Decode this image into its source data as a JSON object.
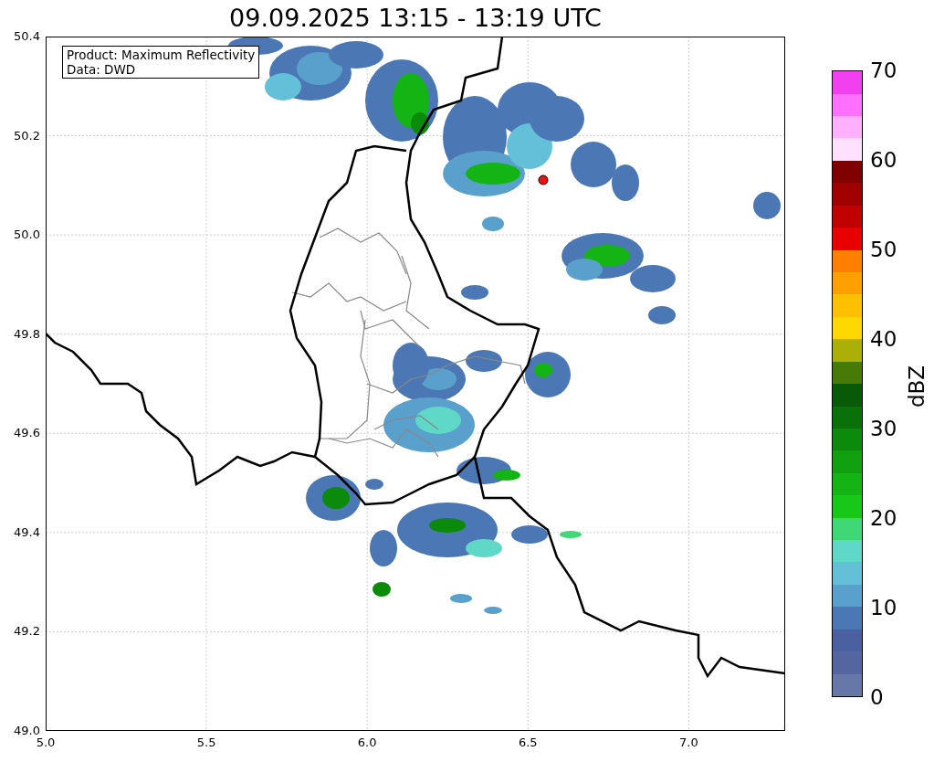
{
  "title": "09.09.2025 13:15 - 13:19 UTC",
  "info_box": [
    "Product: Maximum Reflectivity",
    "Data: DWD"
  ],
  "yticks": [
    "50.4",
    "50.2",
    "50.0",
    "49.8",
    "49.6",
    "49.4",
    "49.2",
    "49.0"
  ],
  "xticks": [
    "5.0",
    "5.5",
    "6.0",
    "6.5",
    "7.0"
  ],
  "colorbar": {
    "label": "dBZ",
    "ticks": [
      "70",
      "60",
      "50",
      "40",
      "30",
      "20",
      "10",
      "0"
    ],
    "segments": [
      {
        "color": "#6777a8"
      },
      {
        "color": "#5565a0"
      },
      {
        "color": "#4a60a0"
      },
      {
        "color": "#4b78b4"
      },
      {
        "color": "#5aa0cc"
      },
      {
        "color": "#63c0d8"
      },
      {
        "color": "#60d8c8"
      },
      {
        "color": "#40d877"
      },
      {
        "color": "#18c818"
      },
      {
        "color": "#14b414"
      },
      {
        "color": "#10a010"
      },
      {
        "color": "#0c8a0c"
      },
      {
        "color": "#0a700a"
      },
      {
        "color": "#085a08"
      },
      {
        "color": "#487a08"
      },
      {
        "color": "#aab008"
      },
      {
        "color": "#ffd800"
      },
      {
        "color": "#ffc000"
      },
      {
        "color": "#ffa000"
      },
      {
        "color": "#ff8000"
      },
      {
        "color": "#e80000"
      },
      {
        "color": "#c00000"
      },
      {
        "color": "#a00000"
      },
      {
        "color": "#800000"
      },
      {
        "color": "#ffe0ff"
      },
      {
        "color": "#ffb0ff"
      },
      {
        "color": "#ff70ff"
      },
      {
        "color": "#f040f0"
      }
    ]
  }
}
